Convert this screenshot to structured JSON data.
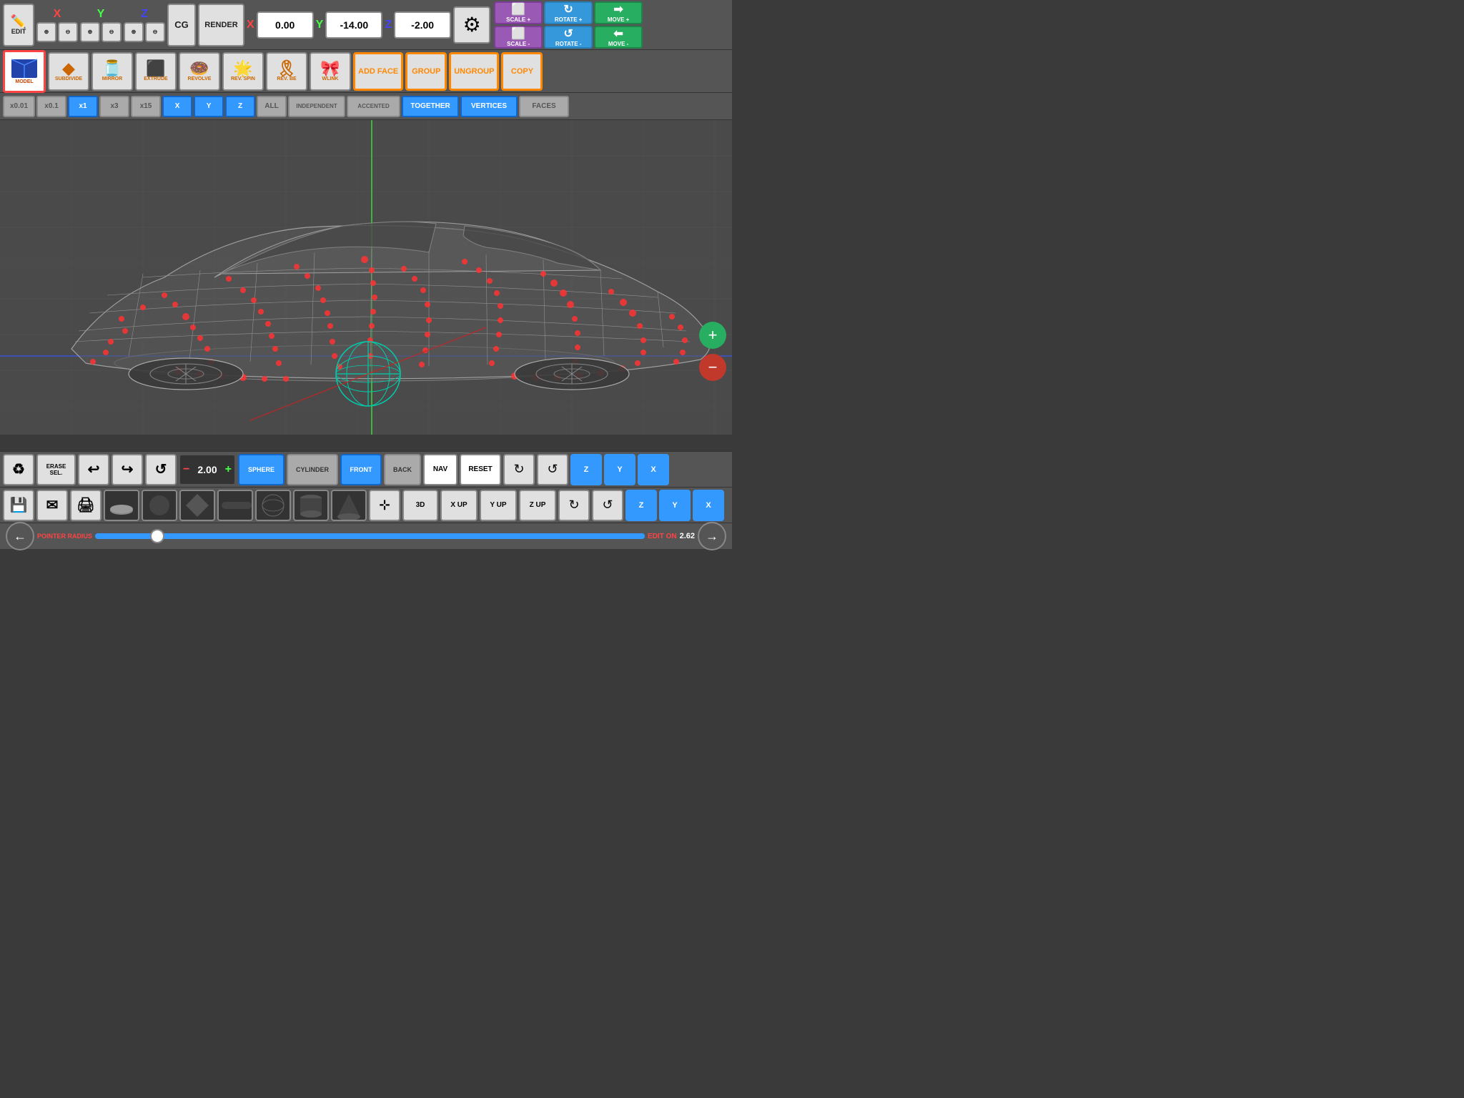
{
  "header": {
    "edit_label": "EDIT",
    "cg_label": "CG",
    "render_label": "RENDER",
    "x_coord": "0.00",
    "y_coord": "-14.00",
    "z_coord": "-2.00",
    "x_axis": "X",
    "y_axis": "Y",
    "z_axis": "Z"
  },
  "nav_arrows": {
    "x_pos": "→",
    "x_neg": "←",
    "y_pos": "↑",
    "y_neg": "↓",
    "z_pos": "↗",
    "z_neg": "↙"
  },
  "toolbar": {
    "model_label": "MODEL",
    "subdivide_label": "SUBDIVIDE",
    "mirror_label": "MIRROR",
    "extrude_label": "EXTRUDE",
    "revolve_label": "REVOLVE",
    "rev_spin_label": "REV. SPIN",
    "rev_be_label": "REV. BE",
    "wlink_label": "WLINK",
    "add_face_label": "ADD FACE",
    "group_label": "GROUP",
    "ungroup_label": "UNGROUP",
    "copy_label": "COPY"
  },
  "scale_buttons": {
    "scale_plus": "SCALE +",
    "rotate_plus": "ROTATE +",
    "move_plus": "MOVE +",
    "scale_minus": "SCALE -",
    "rotate_minus": "ROTATE -",
    "move_minus": "MOVE -"
  },
  "axis_toolbar": {
    "x001": "x0.01",
    "x01": "x0.1",
    "x1": "x1",
    "x3": "x3",
    "x15": "x15",
    "x": "X",
    "y": "Y",
    "z": "Z",
    "all": "ALL",
    "independent": "INDEPENDENT",
    "accented": "ACCENTED",
    "together": "TOGETHER",
    "vertices": "VERTICES",
    "faces": "FACES"
  },
  "bottom": {
    "erase_sel": "ERASE\nSEL.",
    "sphere_label": "SPHERE",
    "cylinder_label": "CYLINDER",
    "front_label": "FRONT",
    "back_label": "BACK",
    "nav_label": "NAV",
    "reset_label": "RESET",
    "value": "2.00",
    "three_d": "3D",
    "x_up": "X UP",
    "y_up": "Y UP",
    "z_up": "Z UP",
    "pointer_radius": "POINTER RADIUS",
    "radius_value": "2.62",
    "edit_on": "EDIT ON"
  }
}
